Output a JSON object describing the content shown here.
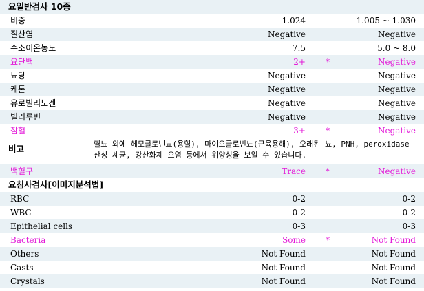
{
  "section1": {
    "title": "요일반검사 10종",
    "rows": [
      {
        "name": "비중",
        "value": "1.024",
        "flag": "",
        "ref": "1.005 ~ 1.030",
        "abnormal": false
      },
      {
        "name": "질산염",
        "value": "Negative",
        "flag": "",
        "ref": "Negative",
        "abnormal": false
      },
      {
        "name": "수소이온농도",
        "value": "7.5",
        "flag": "",
        "ref": "5.0 ~ 8.0",
        "abnormal": false
      },
      {
        "name": "요단백",
        "value": "2+",
        "flag": "*",
        "ref": "Negative",
        "abnormal": true
      },
      {
        "name": "뇨당",
        "value": "Negative",
        "flag": "",
        "ref": "Negative",
        "abnormal": false
      },
      {
        "name": "케톤",
        "value": "Negative",
        "flag": "",
        "ref": "Negative",
        "abnormal": false
      },
      {
        "name": "유로빌리노겐",
        "value": "Negative",
        "flag": "",
        "ref": "Negative",
        "abnormal": false
      },
      {
        "name": "빌리루빈",
        "value": "Negative",
        "flag": "",
        "ref": "Negative",
        "abnormal": false
      },
      {
        "name": "잠혈",
        "value": "3+",
        "flag": "*",
        "ref": "Negative",
        "abnormal": true
      }
    ]
  },
  "note": {
    "label": "비고",
    "text": "혈뇨 외에 헤모글로빈뇨(용혈), 마이오글로빈뇨(근육용해), 오래된 뇨, PNH, peroxidase 산성 세균, 강산화제 오염 등에서 위양성을 보일 수 있습니다."
  },
  "wbc_row": {
    "name": "백혈구",
    "value": "Trace",
    "flag": "*",
    "ref": "Negative",
    "abnormal": true
  },
  "section2": {
    "title": "요침사검사[이미지분석법]",
    "rows": [
      {
        "name": "RBC",
        "value": "0-2",
        "flag": "",
        "ref": "0-2",
        "abnormal": false
      },
      {
        "name": "WBC",
        "value": "0-2",
        "flag": "",
        "ref": "0-2",
        "abnormal": false
      },
      {
        "name": "Epithelial cells",
        "value": "0-3",
        "flag": "",
        "ref": "0-3",
        "abnormal": false
      },
      {
        "name": "Bacteria",
        "value": "Some",
        "flag": "*",
        "ref": "Not Found",
        "abnormal": true
      },
      {
        "name": "Others",
        "value": "Not Found",
        "flag": "",
        "ref": "Not Found",
        "abnormal": false
      },
      {
        "name": "Casts",
        "value": "Not Found",
        "flag": "",
        "ref": "Not Found",
        "abnormal": false
      },
      {
        "name": "Crystals",
        "value": "Not Found",
        "flag": "",
        "ref": "Not Found",
        "abnormal": false
      }
    ]
  },
  "colors": {
    "abnormal": "#e31ad8",
    "row_alt": "#e9f1f5"
  }
}
